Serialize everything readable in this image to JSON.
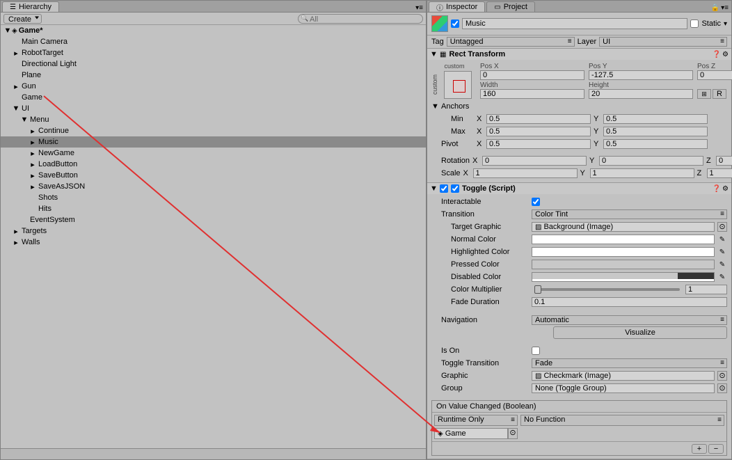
{
  "left": {
    "tab": "Hierarchy",
    "create": "Create",
    "search_all": "All",
    "tree": {
      "root": "Game*",
      "items": [
        {
          "label": "Main Camera",
          "indent": 1,
          "arrow": null
        },
        {
          "label": "RobotTarget",
          "indent": 1,
          "arrow": "right",
          "gray": false
        },
        {
          "label": "Directional Light",
          "indent": 1,
          "arrow": null
        },
        {
          "label": "Plane",
          "indent": 1,
          "arrow": null
        },
        {
          "label": "Gun",
          "indent": 1,
          "arrow": "right"
        },
        {
          "label": "Game",
          "indent": 1,
          "arrow": null
        },
        {
          "label": "UI",
          "indent": 1,
          "arrow": "down"
        },
        {
          "label": "Menu",
          "indent": 2,
          "arrow": "down"
        },
        {
          "label": "Continue",
          "indent": 3,
          "arrow": "right"
        },
        {
          "label": "Music",
          "indent": 3,
          "arrow": "right",
          "selected": true
        },
        {
          "label": "NewGame",
          "indent": 3,
          "arrow": "right"
        },
        {
          "label": "LoadButton",
          "indent": 3,
          "arrow": "right"
        },
        {
          "label": "SaveButton",
          "indent": 3,
          "arrow": "right"
        },
        {
          "label": "SaveAsJSON",
          "indent": 3,
          "arrow": "right"
        },
        {
          "label": "Shots",
          "indent": 3,
          "arrow": null
        },
        {
          "label": "Hits",
          "indent": 3,
          "arrow": null
        },
        {
          "label": "EventSystem",
          "indent": 2,
          "arrow": null
        },
        {
          "label": "Targets",
          "indent": 1,
          "arrow": "right"
        },
        {
          "label": "Walls",
          "indent": 1,
          "arrow": "right"
        }
      ]
    }
  },
  "right": {
    "tabs": {
      "inspector": "Inspector",
      "project": "Project"
    },
    "go": {
      "name": "Music",
      "static": "Static"
    },
    "tag": {
      "label": "Tag",
      "value": "Untagged"
    },
    "layer": {
      "label": "Layer",
      "value": "UI"
    },
    "rect": {
      "title": "Rect Transform",
      "custom": "custom",
      "posx": {
        "label": "Pos X",
        "value": "0"
      },
      "posy": {
        "label": "Pos Y",
        "value": "-127.5"
      },
      "posz": {
        "label": "Pos Z",
        "value": "0"
      },
      "width": {
        "label": "Width",
        "value": "160"
      },
      "height": {
        "label": "Height",
        "value": "20"
      },
      "anchors": "Anchors",
      "min": "Min",
      "max": "Max",
      "pivot": "Pivot",
      "min_x": "0.5",
      "min_y": "0.5",
      "max_x": "0.5",
      "max_y": "0.5",
      "pivot_x": "0.5",
      "pivot_y": "0.5",
      "rotation": "Rotation",
      "rot_x": "0",
      "rot_y": "0",
      "rot_z": "0",
      "scale": "Scale",
      "scale_x": "1",
      "scale_y": "1",
      "scale_z": "1",
      "x": "X",
      "y": "Y",
      "z": "Z",
      "r_btn": "R"
    },
    "toggle": {
      "title": "Toggle (Script)",
      "interactable": "Interactable",
      "transition": "Transition",
      "transition_val": "Color Tint",
      "target_graphic": "Target Graphic",
      "target_val": "Background (Image)",
      "normal": "Normal Color",
      "highlighted": "Highlighted Color",
      "pressed": "Pressed Color",
      "disabled": "Disabled Color",
      "multiplier": "Color Multiplier",
      "mult_val": "1",
      "fade": "Fade Duration",
      "fade_val": "0.1",
      "navigation": "Navigation",
      "nav_val": "Automatic",
      "visualize": "Visualize",
      "ison": "Is On",
      "toggle_trans": "Toggle Transition",
      "toggle_trans_val": "Fade",
      "graphic": "Graphic",
      "graphic_val": "Checkmark (Image)",
      "group": "Group",
      "group_val": "None (Toggle Group)"
    },
    "event": {
      "header": "On Value Changed (Boolean)",
      "runtime": "Runtime Only",
      "func": "No Function",
      "target": "Game",
      "plus": "+",
      "minus": "−"
    }
  }
}
